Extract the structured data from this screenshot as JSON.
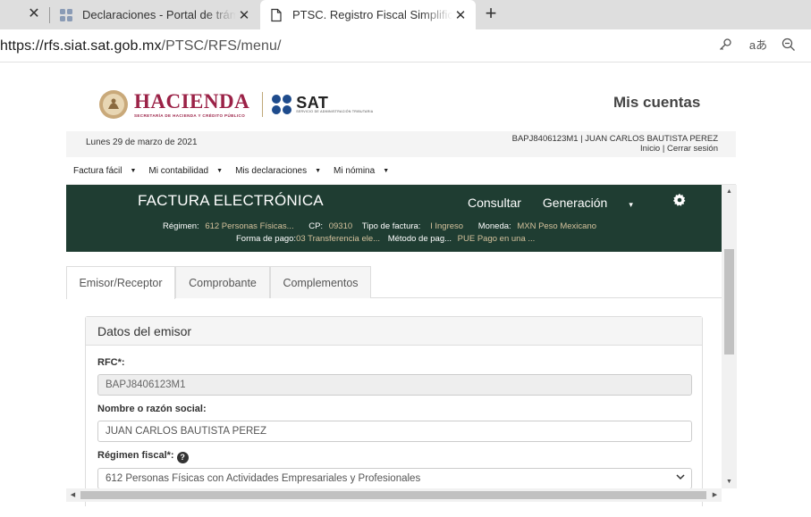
{
  "browser": {
    "tabs": [
      {
        "title": "Declaraciones - Portal de trámites",
        "close": "✕"
      },
      {
        "title": "PTSC. Registro Fiscal Simplificado",
        "close": "✕"
      }
    ],
    "stub_close": "✕",
    "new_tab": "+",
    "url_host": "https://rfs.siat.sat.gob.mx",
    "url_path": "/PTSC/RFS/menu/",
    "icons": [
      "key-icon",
      "read-aloud-icon",
      "zoom-out-icon"
    ],
    "read_aloud_glyph": "aあ"
  },
  "header": {
    "hacienda": "HACIENDA",
    "hacienda_sub": "SECRETARÍA DE HACIENDA Y CRÉDITO PÚBLICO",
    "sat": "SAT",
    "sat_sub": "SERVICIO DE ADMINISTRACIÓN TRIBUTARIA",
    "mis_cuentas": "Mis cuentas",
    "brand_color": "#9b2247"
  },
  "infobar": {
    "date": "Lunes 29 de marzo de 2021",
    "user": "BAPJ8406123M1 | JUAN CARLOS BAUTISTA PEREZ",
    "inicio": "Inicio",
    "sep": " | ",
    "cerrar": "Cerrar sesión"
  },
  "menu": [
    {
      "label": "Factura fácil"
    },
    {
      "label": "Mi contabilidad"
    },
    {
      "label": "Mis declaraciones"
    },
    {
      "label": "Mi nómina"
    }
  ],
  "factura": {
    "title": "FACTURA ELECTRÓNICA",
    "nav": {
      "consultar": "Consultar",
      "generacion": "Generación",
      "caret": "▾"
    },
    "bg_color": "#1f3d32",
    "value_color": "#d4c19c",
    "regimen_k": "Régimen:",
    "regimen_v": "612 Personas Físicas...",
    "cp_k": "CP:",
    "cp_v": "09310",
    "tipo_k": "Tipo de factura:",
    "tipo_v": "I Ingreso",
    "moneda_k": "Moneda:",
    "moneda_v": "MXN Peso Mexicano",
    "forma_k": "Forma de pago:",
    "forma_v": "03 Transferencia ele...",
    "metodo_k": "Método de pag...",
    "metodo_v": "PUE Pago en una ..."
  },
  "tabs": [
    {
      "label": "Emisor/Receptor",
      "active": true
    },
    {
      "label": "Comprobante",
      "active": false
    },
    {
      "label": "Complementos",
      "active": false
    }
  ],
  "emisor": {
    "heading": "Datos del emisor",
    "rfc_label": "RFC*:",
    "rfc_value": "BAPJ8406123M1",
    "nombre_label": "Nombre o razón social:",
    "nombre_value": "JUAN CARLOS BAUTISTA PEREZ",
    "regimen_label": "Régimen fiscal*:",
    "regimen_value": "612 Personas Físicas con Actividades Empresariales y Profesionales",
    "help": "?"
  }
}
